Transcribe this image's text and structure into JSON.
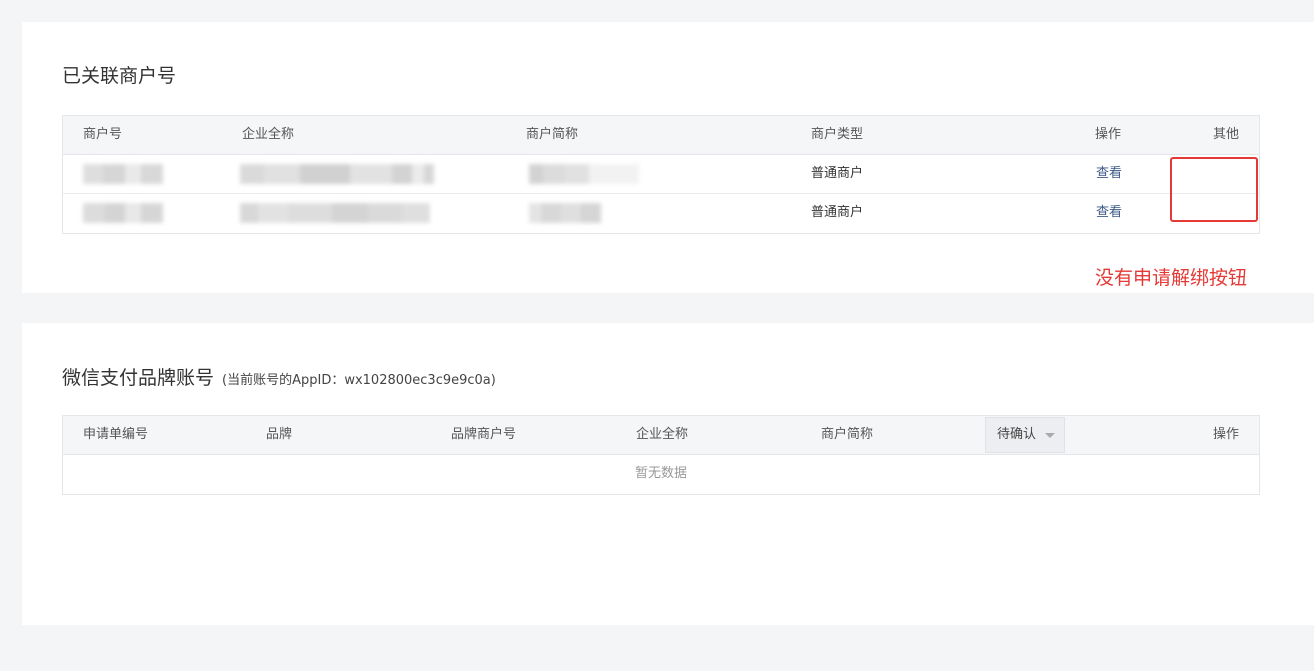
{
  "linked_merchants": {
    "title": "已关联商户号",
    "columns": [
      "商户号",
      "企业全称",
      "商户简称",
      "商户类型",
      "操作",
      "其他"
    ],
    "rows": [
      {
        "merchant_type": "普通商户",
        "action": "查看"
      },
      {
        "merchant_type": "普通商户",
        "action": "查看"
      }
    ]
  },
  "annotation": {
    "text": "没有申请解绑按钮",
    "color": "#e53935"
  },
  "brand_accounts": {
    "title": "微信支付品牌账号",
    "subtitle": "(当前账号的AppID：wx102800ec3c9e9c0a)",
    "columns": [
      "申请单编号",
      "品牌",
      "品牌商户号",
      "企业全称",
      "商户简称",
      "待确认",
      "操作"
    ],
    "status_filter": "待确认",
    "empty_text": "暂无数据"
  },
  "colors": {
    "link": "#3d5a87",
    "header_bg": "#f5f6f8",
    "page_bg": "#f4f5f7"
  }
}
